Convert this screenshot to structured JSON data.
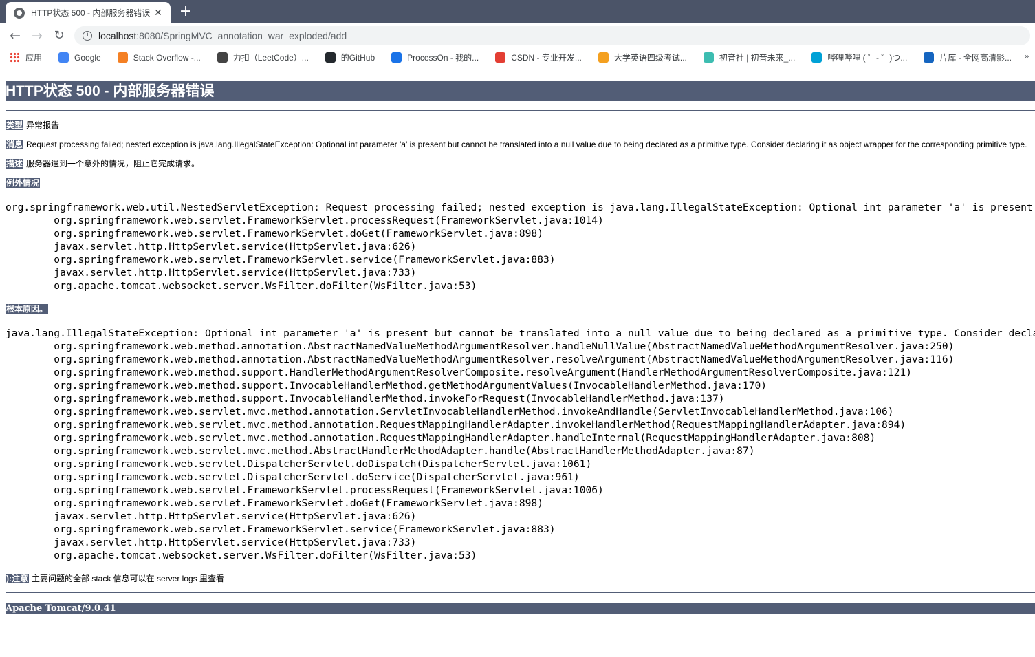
{
  "browser": {
    "tab_title": "HTTP状态 500 - 内部服务器错误",
    "tab_close": "✕",
    "new_tab": "+",
    "url_host": "localhost",
    "url_rest": ":8080/SpringMVC_annotation_war_exploded/add",
    "bookmarks": [
      {
        "label": "应用",
        "icon": "apps-icon",
        "color": "#4285f4"
      },
      {
        "label": "Google",
        "icon": "google-icon",
        "color": "#4285f4"
      },
      {
        "label": "Stack Overflow -...",
        "icon": "stackoverflow-icon",
        "color": "#f48024"
      },
      {
        "label": "力扣（LeetCode）...",
        "icon": "leetcode-icon",
        "color": "#444444"
      },
      {
        "label": "的GitHub",
        "icon": "github-icon",
        "color": "#24292e"
      },
      {
        "label": "ProcessOn - 我的...",
        "icon": "processon-icon",
        "color": "#1a73e8"
      },
      {
        "label": "CSDN - 专业开发...",
        "icon": "csdn-icon",
        "color": "#e33e33"
      },
      {
        "label": "大学英语四级考试...",
        "icon": "cet-icon",
        "color": "#f4a020"
      },
      {
        "label": "初音社 | 初音未来_...",
        "icon": "chuyin-icon",
        "color": "#3dbdb1"
      },
      {
        "label": "哔哩哔哩 ( ゜- ゜)つ...",
        "icon": "bilibili-icon",
        "color": "#00a1d6"
      },
      {
        "label": "片库 - 全网高清影...",
        "icon": "pianku-icon",
        "color": "#1565c0"
      }
    ],
    "bookmarks_more": "»"
  },
  "error": {
    "heading": "HTTP状态 500 - 内部服务器错误",
    "type_label": "类型",
    "type_value": "异常报告",
    "message_label": "消息",
    "message_value": "Request processing failed; nested exception is java.lang.IllegalStateException: Optional int parameter 'a' is present but cannot be translated into a null value due to being declared as a primitive type. Consider declaring it as object wrapper for the corresponding primitive type.",
    "description_label": "描述",
    "description_value": "服务器遇到一个意外的情况，阻止它完成请求。",
    "exception_label": "例外情况",
    "exception_trace": "org.springframework.web.util.NestedServletException: Request processing failed; nested exception is java.lang.IllegalStateException: Optional int parameter 'a' is present but cannot be translated into a null value due to being declared as a primitive type. Consider declaring it as object wrapper for the corresponding primitive type.\n\torg.springframework.web.servlet.FrameworkServlet.processRequest(FrameworkServlet.java:1014)\n\torg.springframework.web.servlet.FrameworkServlet.doGet(FrameworkServlet.java:898)\n\tjavax.servlet.http.HttpServlet.service(HttpServlet.java:626)\n\torg.springframework.web.servlet.FrameworkServlet.service(FrameworkServlet.java:883)\n\tjavax.servlet.http.HttpServlet.service(HttpServlet.java:733)\n\torg.apache.tomcat.websocket.server.WsFilter.doFilter(WsFilter.java:53)",
    "root_cause_label": "根本原因。",
    "root_cause_trace": "java.lang.IllegalStateException: Optional int parameter 'a' is present but cannot be translated into a null value due to being declared as a primitive type. Consider declaring it as object wrapper for the corresponding primitive type.\n\torg.springframework.web.method.annotation.AbstractNamedValueMethodArgumentResolver.handleNullValue(AbstractNamedValueMethodArgumentResolver.java:250)\n\torg.springframework.web.method.annotation.AbstractNamedValueMethodArgumentResolver.resolveArgument(AbstractNamedValueMethodArgumentResolver.java:116)\n\torg.springframework.web.method.support.HandlerMethodArgumentResolverComposite.resolveArgument(HandlerMethodArgumentResolverComposite.java:121)\n\torg.springframework.web.method.support.InvocableHandlerMethod.getMethodArgumentValues(InvocableHandlerMethod.java:170)\n\torg.springframework.web.method.support.InvocableHandlerMethod.invokeForRequest(InvocableHandlerMethod.java:137)\n\torg.springframework.web.servlet.mvc.method.annotation.ServletInvocableHandlerMethod.invokeAndHandle(ServletInvocableHandlerMethod.java:106)\n\torg.springframework.web.servlet.mvc.method.annotation.RequestMappingHandlerAdapter.invokeHandlerMethod(RequestMappingHandlerAdapter.java:894)\n\torg.springframework.web.servlet.mvc.method.annotation.RequestMappingHandlerAdapter.handleInternal(RequestMappingHandlerAdapter.java:808)\n\torg.springframework.web.servlet.mvc.method.AbstractHandlerMethodAdapter.handle(AbstractHandlerMethodAdapter.java:87)\n\torg.springframework.web.servlet.DispatcherServlet.doDispatch(DispatcherServlet.java:1061)\n\torg.springframework.web.servlet.DispatcherServlet.doService(DispatcherServlet.java:961)\n\torg.springframework.web.servlet.FrameworkServlet.processRequest(FrameworkServlet.java:1006)\n\torg.springframework.web.servlet.FrameworkServlet.doGet(FrameworkServlet.java:898)\n\tjavax.servlet.http.HttpServlet.service(HttpServlet.java:626)\n\torg.springframework.web.servlet.FrameworkServlet.service(FrameworkServlet.java:883)\n\tjavax.servlet.http.HttpServlet.service(HttpServlet.java:733)\n\torg.apache.tomcat.websocket.server.WsFilter.doFilter(WsFilter.java:53)",
    "note_label": "):注意",
    "note_value": "主要问题的全部 stack 信息可以在 server logs 里查看",
    "footer": "Apache Tomcat/9.0.41"
  }
}
